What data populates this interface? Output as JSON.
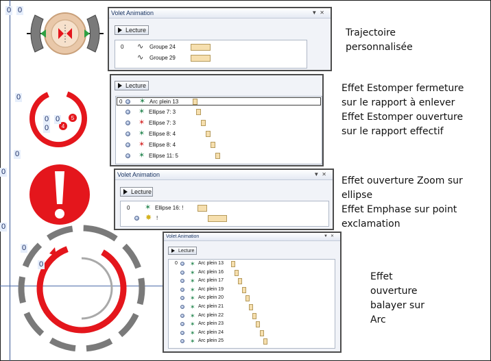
{
  "tags": {
    "t1a": "0",
    "t1b": "0",
    "t2": "0",
    "t3a": "0",
    "t3b": "0",
    "t3c": "0",
    "t4": "0",
    "t5": "0",
    "t6": "0",
    "t7": "0",
    "t8": "0",
    "badge_red": "5",
    "badge_red2": "4"
  },
  "pane1": {
    "title": "Volet Animation",
    "play": "Lecture",
    "rows": [
      {
        "num": "0",
        "label": "Groupe 24"
      },
      {
        "num": "",
        "label": "Groupe 29"
      }
    ]
  },
  "pane2": {
    "play": "Lecture",
    "rows": [
      {
        "num": "0",
        "label": "Arc plein 13",
        "color": "#2e8b57"
      },
      {
        "num": "",
        "label": "Ellipse 7: 3",
        "color": "#2e8b57"
      },
      {
        "num": "",
        "label": "Ellipse 7: 3",
        "color": "#d83434"
      },
      {
        "num": "",
        "label": "Ellipse 8: 4",
        "color": "#2e8b57"
      },
      {
        "num": "",
        "label": "Ellipse 8: 4",
        "color": "#d83434"
      },
      {
        "num": "",
        "label": "Ellipse 11: 5",
        "color": "#2e8b57"
      }
    ]
  },
  "pane3": {
    "title": "Volet Animation",
    "play": "Lecture",
    "rows": [
      {
        "num": "0",
        "label": "Ellipse 16: !"
      },
      {
        "num": "",
        "label": "!"
      }
    ]
  },
  "pane4": {
    "title": "Volet Animation",
    "play": "Lecture",
    "rows": [
      {
        "num": "0",
        "label": "Arc plein 13"
      },
      {
        "num": "",
        "label": "Arc plein 16"
      },
      {
        "num": "",
        "label": "Arc plein 17"
      },
      {
        "num": "",
        "label": "Arc plein 19"
      },
      {
        "num": "",
        "label": "Arc plein 20"
      },
      {
        "num": "",
        "label": "Arc plein 21"
      },
      {
        "num": "",
        "label": "Arc plein 22"
      },
      {
        "num": "",
        "label": "Arc plein 23"
      },
      {
        "num": "",
        "label": "Arc plein 24"
      },
      {
        "num": "",
        "label": "Arc plein 25"
      }
    ]
  },
  "desc1": {
    "l1": "Trajectoire",
    "l2": "personnalisée"
  },
  "desc2": {
    "l1": "Effet Estomper fermeture",
    "l2": "sur le rapport à enlever",
    "l3": "Effet Estomper ouverture",
    "l4": "sur le rapport effectif"
  },
  "desc3": {
    "l1": "Effet ouverture Zoom sur",
    "l2": "ellipse",
    "l3": "Effet Emphase sur point",
    "l4": "exclamation"
  },
  "desc4": {
    "l1": "Effet",
    "l2": "ouverture",
    "l3": "balayer sur",
    "l4": "Arc"
  },
  "colors": {
    "accent_red": "#e4161c",
    "gray_ring": "#7a7a7a",
    "bar_fill": "#f6dfae"
  }
}
